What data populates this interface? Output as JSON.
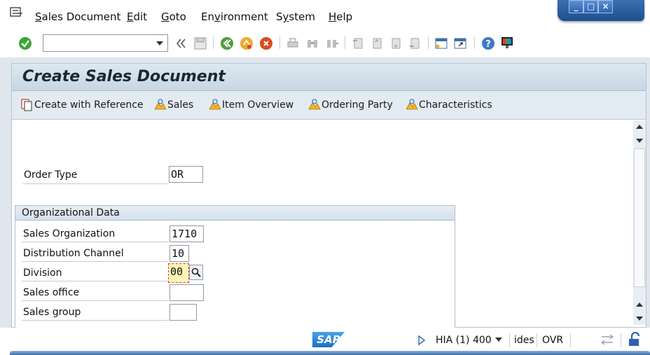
{
  "menubar": {
    "items": [
      "Sales Document",
      "Edit",
      "Goto",
      "Environment",
      "System",
      "Help"
    ],
    "mnemonics": [
      "S",
      "E",
      "G",
      "v",
      "y",
      "H"
    ]
  },
  "window_controls": {
    "minimize": "_",
    "maximize": "□",
    "close": "×"
  },
  "toolbar": {
    "command_placeholder": "",
    "icons": [
      "enter-icon",
      "save-icon",
      "back-icon",
      "exit-icon",
      "cancel-icon",
      "print-icon",
      "find-icon",
      "find-next-icon",
      "first-page-icon",
      "previous-page-icon",
      "next-page-icon",
      "last-page-icon",
      "new-session-icon",
      "shortcut-icon",
      "help-icon",
      "customize-layout-icon"
    ]
  },
  "screen": {
    "title": "Create Sales Document",
    "app_toolbar": [
      {
        "label": "Create with Reference",
        "icon": "copy-document-icon"
      },
      {
        "label": "Sales",
        "icon": "overview-icon"
      },
      {
        "label": "Item Overview",
        "icon": "overview-icon"
      },
      {
        "label": "Ordering Party",
        "icon": "overview-icon"
      },
      {
        "label": "Characteristics",
        "icon": "overview-icon"
      }
    ]
  },
  "form": {
    "order_type": {
      "label": "Order Type",
      "value": "OR"
    },
    "org_group_title": "Organizational Data",
    "sales_org": {
      "label": "Sales Organization",
      "value": "1710"
    },
    "dist_channel": {
      "label": "Distribution Channel",
      "value": "10"
    },
    "division": {
      "label": "Division",
      "value": "00"
    },
    "sales_office": {
      "label": "Sales office",
      "value": ""
    },
    "sales_group": {
      "label": "Sales group",
      "value": ""
    }
  },
  "statusbar": {
    "logo": "SAP",
    "system": "HIA (1) 400",
    "client_host": "ides",
    "mode": "OVR"
  },
  "colors": {
    "accent": "#2d63b0",
    "enter_green": "#3aa637",
    "cancel_red": "#d84a24",
    "focus_yellow": "#fff3b8"
  }
}
